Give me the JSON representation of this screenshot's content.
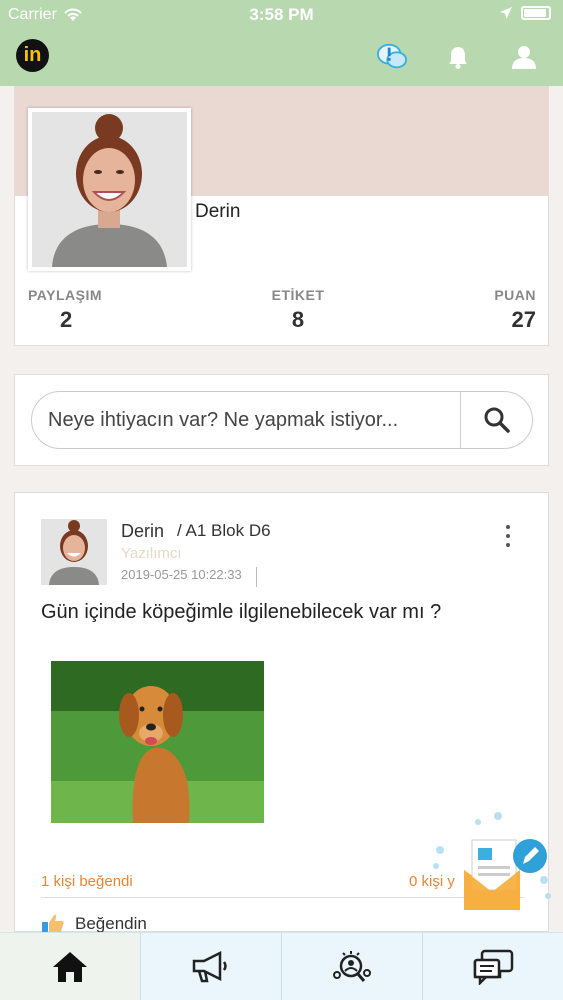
{
  "status_bar": {
    "carrier": "Carrier",
    "time": "3:58 PM"
  },
  "navbar": {
    "logo_text": "in",
    "icons": [
      "alert-chat-icon",
      "bell-icon",
      "user-icon"
    ]
  },
  "profile": {
    "name": "Derin",
    "stats": [
      {
        "label": "PAYLAŞIM",
        "value": "2"
      },
      {
        "label": "ETİKET",
        "value": "8"
      },
      {
        "label": "PUAN",
        "value": "27"
      }
    ]
  },
  "search": {
    "placeholder": "Neye ihtiyacın var? Ne yapmak istiyor..."
  },
  "post": {
    "author": "Derin",
    "location": "/ A1 Blok D6",
    "role": "Yazılımcı",
    "date": "2019-05-25 10:22:33",
    "text": "Gün içinde köpeğimle ilgilenebilecek var mı ?",
    "likes_text": "1 kişi beğendi",
    "comments_text": "0 kişi y",
    "like_action": "Beğendin"
  },
  "tabbar": {
    "tabs": [
      "home-icon",
      "megaphone-icon",
      "search-people-icon",
      "messages-icon"
    ],
    "active_index": 0
  },
  "colors": {
    "header_green": "#b8d8b0",
    "profile_pink": "#ead8d2",
    "accent_orange": "#e0883a",
    "tab_bg": "#eaf6fb"
  }
}
